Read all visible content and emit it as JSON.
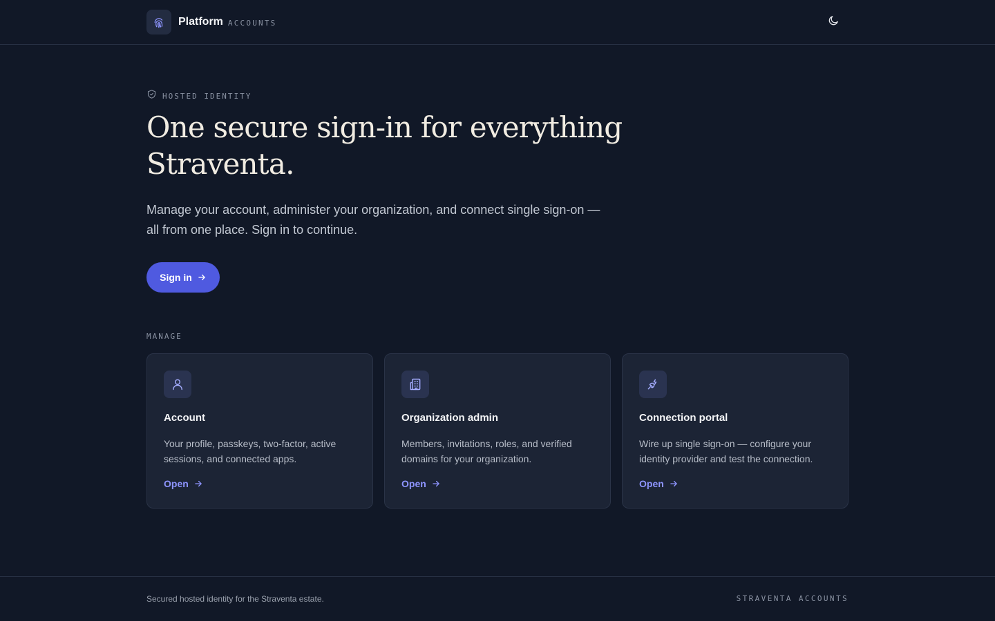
{
  "header": {
    "brand_name": "Platform",
    "brand_sub": "ACCOUNTS",
    "icons": {
      "logo": "fingerprint-icon",
      "theme_toggle": "moon-icon"
    }
  },
  "hero": {
    "eyebrow": "HOSTED IDENTITY",
    "eyebrow_icon": "shield-check-icon",
    "title": "One secure sign-in for everything Straventa.",
    "subtitle": "Manage your account, administer your organization, and connect single sign-on — all from one place. Sign in to continue.",
    "signin_label": "Sign in"
  },
  "manage": {
    "label": "MANAGE",
    "cards": [
      {
        "icon": "user-icon",
        "title": "Account",
        "description": "Your profile, passkeys, two-factor, active sessions, and connected apps.",
        "link": "Open"
      },
      {
        "icon": "building-icon",
        "title": "Organization admin",
        "description": "Members, invitations, roles, and verified domains for your organization.",
        "link": "Open"
      },
      {
        "icon": "plug-icon",
        "title": "Connection portal",
        "description": "Wire up single sign-on — configure your identity provider and test the connection.",
        "link": "Open"
      }
    ]
  },
  "footer": {
    "left": "Secured hosted identity for the Straventa estate.",
    "right": "STRAVENTA ACCOUNTS"
  },
  "colors": {
    "background": "#111827",
    "card": "#1c2435",
    "accent": "#4f5ae0",
    "link": "#8e95ff",
    "heading": "#f1ece2"
  }
}
